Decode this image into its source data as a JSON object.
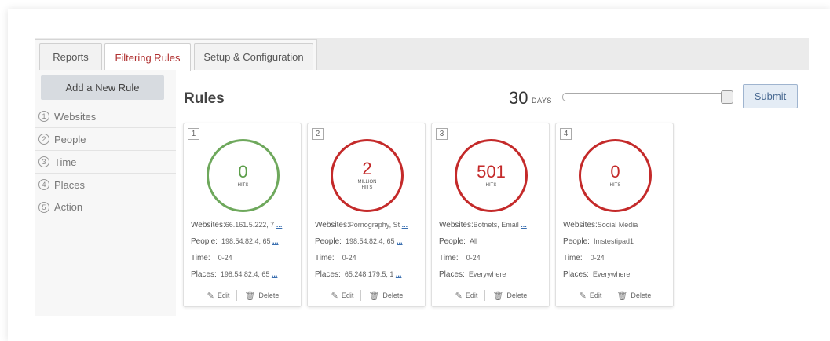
{
  "tabs": [
    {
      "label": "Reports"
    },
    {
      "label": "Filtering Rules"
    },
    {
      "label": "Setup & Configuration"
    }
  ],
  "sidebar": {
    "add_rule": "Add a New Rule",
    "items": [
      {
        "num": "1",
        "label": "Websites"
      },
      {
        "num": "2",
        "label": "People"
      },
      {
        "num": "3",
        "label": "Time"
      },
      {
        "num": "4",
        "label": "Places"
      },
      {
        "num": "5",
        "label": "Action"
      }
    ]
  },
  "main": {
    "title": "Rules",
    "days_value": "30",
    "days_label": "DAYS",
    "submit_label": "Submit"
  },
  "labels": {
    "websites": "Websites:",
    "people": "People:",
    "time": "Time:",
    "places": "Places:",
    "more": "...",
    "edit": "Edit",
    "delete": "Delete"
  },
  "cards": [
    {
      "index": "1",
      "hits": "0",
      "unit": "HITS",
      "unit_top": "",
      "status": "green",
      "websites": "66.161.5.222, 7",
      "websites_more": true,
      "people": "198.54.82.4, 65",
      "people_more": true,
      "time": "0-24",
      "places": "198.54.82.4, 65",
      "places_more": true
    },
    {
      "index": "2",
      "hits": "2",
      "unit": "HITS",
      "unit_top": "MILLION",
      "status": "red",
      "websites": "Pornography, St",
      "websites_more": true,
      "people": "198.54.82.4, 65",
      "people_more": true,
      "time": "0-24",
      "places": "65.248.179.5, 1",
      "places_more": true
    },
    {
      "index": "3",
      "hits": "501",
      "unit": "HITS",
      "unit_top": "",
      "status": "red",
      "websites": "Botnets, Email",
      "websites_more": true,
      "people": "All",
      "people_more": false,
      "time": "0-24",
      "places": "Everywhere",
      "places_more": false
    },
    {
      "index": "4",
      "hits": "0",
      "unit": "HITS",
      "unit_top": "",
      "status": "red",
      "websites": "Social Media",
      "websites_more": false,
      "people": "Imstestipad1",
      "people_more": false,
      "time": "0-24",
      "places": "Everywhere",
      "places_more": false
    }
  ],
  "colors": {
    "green": "#6ea85c",
    "red": "#c42a2a",
    "accent": "#b03030"
  }
}
